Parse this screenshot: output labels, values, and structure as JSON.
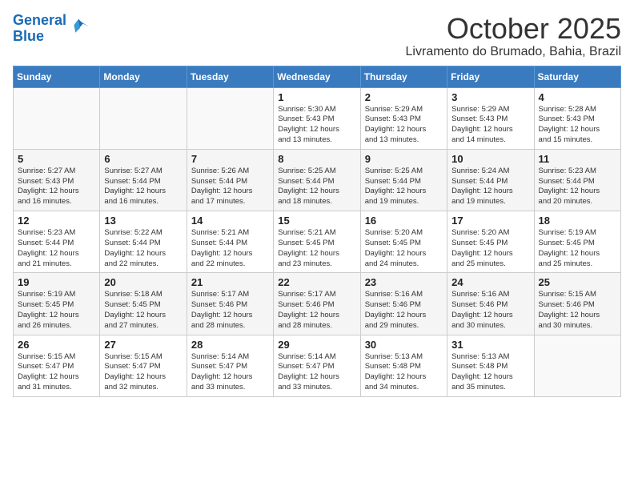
{
  "header": {
    "logo_line1": "General",
    "logo_line2": "Blue",
    "month": "October 2025",
    "location": "Livramento do Brumado, Bahia, Brazil"
  },
  "weekdays": [
    "Sunday",
    "Monday",
    "Tuesday",
    "Wednesday",
    "Thursday",
    "Friday",
    "Saturday"
  ],
  "weeks": [
    [
      {
        "day": "",
        "info": ""
      },
      {
        "day": "",
        "info": ""
      },
      {
        "day": "",
        "info": ""
      },
      {
        "day": "1",
        "info": "Sunrise: 5:30 AM\nSunset: 5:43 PM\nDaylight: 12 hours\nand 13 minutes."
      },
      {
        "day": "2",
        "info": "Sunrise: 5:29 AM\nSunset: 5:43 PM\nDaylight: 12 hours\nand 13 minutes."
      },
      {
        "day": "3",
        "info": "Sunrise: 5:29 AM\nSunset: 5:43 PM\nDaylight: 12 hours\nand 14 minutes."
      },
      {
        "day": "4",
        "info": "Sunrise: 5:28 AM\nSunset: 5:43 PM\nDaylight: 12 hours\nand 15 minutes."
      }
    ],
    [
      {
        "day": "5",
        "info": "Sunrise: 5:27 AM\nSunset: 5:43 PM\nDaylight: 12 hours\nand 16 minutes."
      },
      {
        "day": "6",
        "info": "Sunrise: 5:27 AM\nSunset: 5:44 PM\nDaylight: 12 hours\nand 16 minutes."
      },
      {
        "day": "7",
        "info": "Sunrise: 5:26 AM\nSunset: 5:44 PM\nDaylight: 12 hours\nand 17 minutes."
      },
      {
        "day": "8",
        "info": "Sunrise: 5:25 AM\nSunset: 5:44 PM\nDaylight: 12 hours\nand 18 minutes."
      },
      {
        "day": "9",
        "info": "Sunrise: 5:25 AM\nSunset: 5:44 PM\nDaylight: 12 hours\nand 19 minutes."
      },
      {
        "day": "10",
        "info": "Sunrise: 5:24 AM\nSunset: 5:44 PM\nDaylight: 12 hours\nand 19 minutes."
      },
      {
        "day": "11",
        "info": "Sunrise: 5:23 AM\nSunset: 5:44 PM\nDaylight: 12 hours\nand 20 minutes."
      }
    ],
    [
      {
        "day": "12",
        "info": "Sunrise: 5:23 AM\nSunset: 5:44 PM\nDaylight: 12 hours\nand 21 minutes."
      },
      {
        "day": "13",
        "info": "Sunrise: 5:22 AM\nSunset: 5:44 PM\nDaylight: 12 hours\nand 22 minutes."
      },
      {
        "day": "14",
        "info": "Sunrise: 5:21 AM\nSunset: 5:44 PM\nDaylight: 12 hours\nand 22 minutes."
      },
      {
        "day": "15",
        "info": "Sunrise: 5:21 AM\nSunset: 5:45 PM\nDaylight: 12 hours\nand 23 minutes."
      },
      {
        "day": "16",
        "info": "Sunrise: 5:20 AM\nSunset: 5:45 PM\nDaylight: 12 hours\nand 24 minutes."
      },
      {
        "day": "17",
        "info": "Sunrise: 5:20 AM\nSunset: 5:45 PM\nDaylight: 12 hours\nand 25 minutes."
      },
      {
        "day": "18",
        "info": "Sunrise: 5:19 AM\nSunset: 5:45 PM\nDaylight: 12 hours\nand 25 minutes."
      }
    ],
    [
      {
        "day": "19",
        "info": "Sunrise: 5:19 AM\nSunset: 5:45 PM\nDaylight: 12 hours\nand 26 minutes."
      },
      {
        "day": "20",
        "info": "Sunrise: 5:18 AM\nSunset: 5:45 PM\nDaylight: 12 hours\nand 27 minutes."
      },
      {
        "day": "21",
        "info": "Sunrise: 5:17 AM\nSunset: 5:46 PM\nDaylight: 12 hours\nand 28 minutes."
      },
      {
        "day": "22",
        "info": "Sunrise: 5:17 AM\nSunset: 5:46 PM\nDaylight: 12 hours\nand 28 minutes."
      },
      {
        "day": "23",
        "info": "Sunrise: 5:16 AM\nSunset: 5:46 PM\nDaylight: 12 hours\nand 29 minutes."
      },
      {
        "day": "24",
        "info": "Sunrise: 5:16 AM\nSunset: 5:46 PM\nDaylight: 12 hours\nand 30 minutes."
      },
      {
        "day": "25",
        "info": "Sunrise: 5:15 AM\nSunset: 5:46 PM\nDaylight: 12 hours\nand 30 minutes."
      }
    ],
    [
      {
        "day": "26",
        "info": "Sunrise: 5:15 AM\nSunset: 5:47 PM\nDaylight: 12 hours\nand 31 minutes."
      },
      {
        "day": "27",
        "info": "Sunrise: 5:15 AM\nSunset: 5:47 PM\nDaylight: 12 hours\nand 32 minutes."
      },
      {
        "day": "28",
        "info": "Sunrise: 5:14 AM\nSunset: 5:47 PM\nDaylight: 12 hours\nand 33 minutes."
      },
      {
        "day": "29",
        "info": "Sunrise: 5:14 AM\nSunset: 5:47 PM\nDaylight: 12 hours\nand 33 minutes."
      },
      {
        "day": "30",
        "info": "Sunrise: 5:13 AM\nSunset: 5:48 PM\nDaylight: 12 hours\nand 34 minutes."
      },
      {
        "day": "31",
        "info": "Sunrise: 5:13 AM\nSunset: 5:48 PM\nDaylight: 12 hours\nand 35 minutes."
      },
      {
        "day": "",
        "info": ""
      }
    ]
  ]
}
